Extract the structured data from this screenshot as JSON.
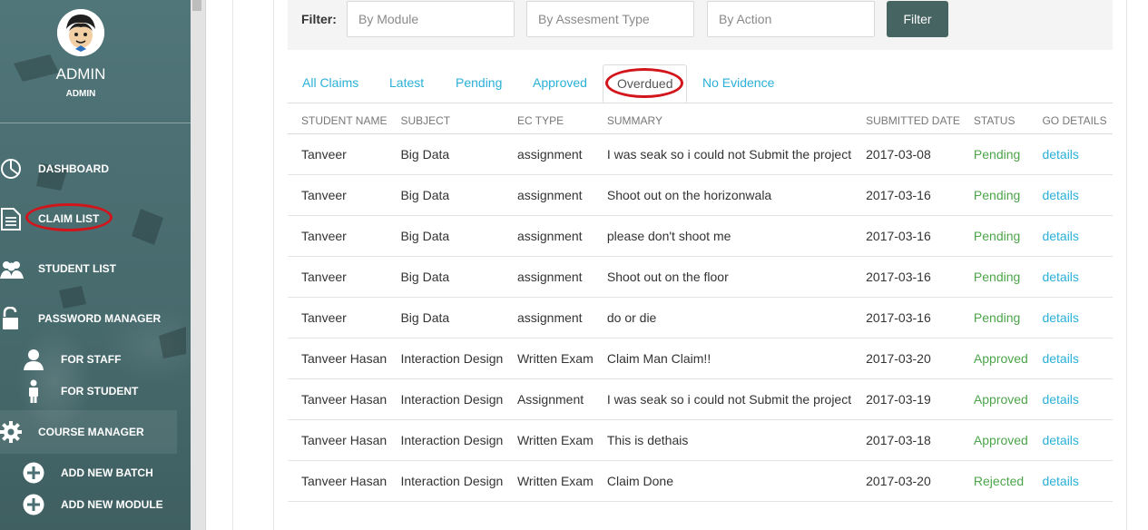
{
  "sidebar": {
    "admin_name": "ADMIN",
    "admin_role": "ADMIN",
    "items": [
      {
        "label": "DASHBOARD",
        "icon": "pie-chart-icon"
      },
      {
        "label": "CLAIM LIST",
        "icon": "document-icon"
      },
      {
        "label": "STUDENT LIST",
        "icon": "users-icon"
      },
      {
        "label": "PASSWORD MANAGER",
        "icon": "unlock-icon"
      },
      {
        "label": "FOR STAFF",
        "icon": "user-icon"
      },
      {
        "label": "FOR STUDENT",
        "icon": "person-icon"
      },
      {
        "label": "COURSE MANAGER",
        "icon": "gear-icon"
      },
      {
        "label": "ADD NEW BATCH",
        "icon": "plus-circle-icon"
      },
      {
        "label": "ADD NEW MODULE",
        "icon": "plus-circle-icon"
      }
    ]
  },
  "filter": {
    "label": "Filter:",
    "module_placeholder": "By Module",
    "assessment_placeholder": "By Assesment Type",
    "action_placeholder": "By Action",
    "button_label": "Filter"
  },
  "tabs": [
    {
      "label": "All Claims"
    },
    {
      "label": "Latest"
    },
    {
      "label": "Pending"
    },
    {
      "label": "Approved"
    },
    {
      "label": "Overdued",
      "active": true
    },
    {
      "label": "No Evidence"
    }
  ],
  "table": {
    "headers": [
      "STUDENT NAME",
      "SUBJECT",
      "EC TYPE",
      "SUMMARY",
      "SUBMITTED DATE",
      "STATUS",
      "GO DETAILS"
    ],
    "rows": [
      {
        "student": "Tanveer",
        "subject": "Big Data",
        "ec_type": "assignment",
        "summary": "I was seak so i could not Submit the project",
        "date": "2017-03-08",
        "status": "Pending",
        "details": "details"
      },
      {
        "student": "Tanveer",
        "subject": "Big Data",
        "ec_type": "assignment",
        "summary": "Shoot out on the horizonwala",
        "date": "2017-03-16",
        "status": "Pending",
        "details": "details"
      },
      {
        "student": "Tanveer",
        "subject": "Big Data",
        "ec_type": "assignment",
        "summary": "please don't shoot me",
        "date": "2017-03-16",
        "status": "Pending",
        "details": "details"
      },
      {
        "student": "Tanveer",
        "subject": "Big Data",
        "ec_type": "assignment",
        "summary": "Shoot out on the floor",
        "date": "2017-03-16",
        "status": "Pending",
        "details": "details"
      },
      {
        "student": "Tanveer",
        "subject": "Big Data",
        "ec_type": "assignment",
        "summary": "do or die",
        "date": "2017-03-16",
        "status": "Pending",
        "details": "details"
      },
      {
        "student": "Tanveer Hasan",
        "subject": "Interaction Design",
        "ec_type": "Written Exam",
        "summary": "Claim Man Claim!!",
        "date": "2017-03-20",
        "status": "Approved",
        "details": "details"
      },
      {
        "student": "Tanveer Hasan",
        "subject": "Interaction Design",
        "ec_type": "Assignment",
        "summary": "I was seak so i could not Submit the project",
        "date": "2017-03-19",
        "status": "Approved",
        "details": "details"
      },
      {
        "student": "Tanveer Hasan",
        "subject": "Interaction Design",
        "ec_type": "Written Exam",
        "summary": "This is dethais",
        "date": "2017-03-18",
        "status": "Approved",
        "details": "details"
      },
      {
        "student": "Tanveer Hasan",
        "subject": "Interaction Design",
        "ec_type": "Written Exam",
        "summary": "Claim Done",
        "date": "2017-03-20",
        "status": "Rejected",
        "details": "details"
      }
    ]
  },
  "colors": {
    "sidebar_bg": "#4b6f72",
    "accent_link": "#2bb0d8",
    "status_green": "#4ca54a",
    "filter_button": "#456462",
    "annotation_red": "#d2141b"
  }
}
